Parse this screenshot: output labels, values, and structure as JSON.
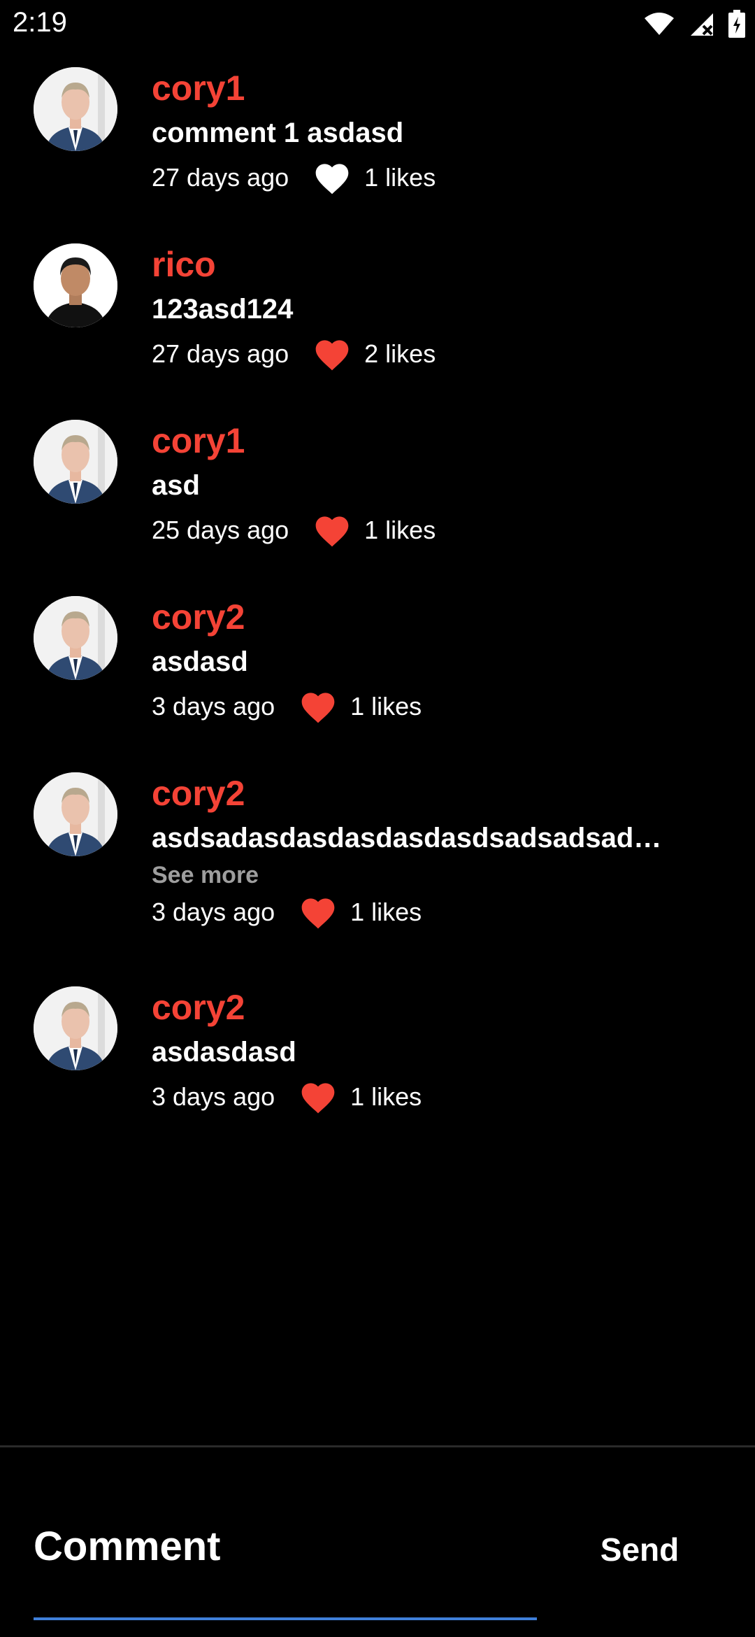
{
  "status_bar": {
    "time": "2:19"
  },
  "comments": [
    {
      "user": "cory1",
      "text": "comment 1 asdasd",
      "time": "27 days ago",
      "likes": "1 likes",
      "liked": false,
      "more": ""
    },
    {
      "user": "rico",
      "text": "123asd124",
      "time": "27 days ago",
      "likes": "2 likes",
      "liked": true,
      "more": ""
    },
    {
      "user": "cory1",
      "text": "asd",
      "time": "25 days ago",
      "likes": "1 likes",
      "liked": true,
      "more": ""
    },
    {
      "user": "cory2",
      "text": "asdasd",
      "time": "3 days ago",
      "likes": "1 likes",
      "liked": true,
      "more": ""
    },
    {
      "user": "cory2",
      "text": "asdsadasdasdasdasdasdsadsadsad…",
      "time": "3 days ago",
      "likes": "1 likes",
      "liked": true,
      "more": "See more"
    },
    {
      "user": "cory2",
      "text": "asdasdasd",
      "time": "3 days ago",
      "likes": "1 likes",
      "liked": true,
      "more": ""
    }
  ],
  "composer": {
    "placeholder": "Comment",
    "send_label": "Send"
  },
  "colors": {
    "username": "#f44336",
    "heart_liked": "#f44336",
    "heart_unliked": "#ffffff",
    "underline": "#3f7fd9"
  }
}
